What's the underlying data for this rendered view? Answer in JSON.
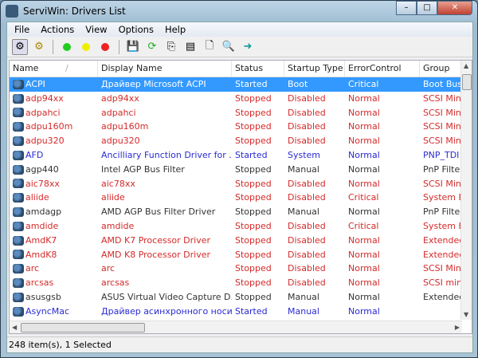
{
  "window": {
    "title": "ServiWin: Drivers List",
    "minimize": "–",
    "maximize": "□",
    "close": "✕"
  },
  "menu": [
    "File",
    "Actions",
    "View",
    "Options",
    "Help"
  ],
  "colors": {
    "red": "#d42a2a",
    "blue": "#2a2ad4",
    "selected": "#3399ff"
  },
  "columns": [
    "Name",
    "Display Name",
    "Status",
    "Startup Type",
    "ErrorControl",
    "Group"
  ],
  "sort_indicator": "/",
  "rows": [
    [
      "ACPI",
      "Драйвер Microsoft ACPI",
      "Started",
      "Boot",
      "Critical",
      "Boot Bus",
      "sel"
    ],
    [
      "adp94xx",
      "adp94xx",
      "Stopped",
      "Disabled",
      "Normal",
      "SCSI Mini",
      "red"
    ],
    [
      "adpahci",
      "adpahci",
      "Stopped",
      "Disabled",
      "Normal",
      "SCSI Mini",
      "red"
    ],
    [
      "adpu160m",
      "adpu160m",
      "Stopped",
      "Disabled",
      "Normal",
      "SCSI Mini",
      "red"
    ],
    [
      "adpu320",
      "adpu320",
      "Stopped",
      "Disabled",
      "Normal",
      "SCSI Mini",
      "red"
    ],
    [
      "AFD",
      "Ancilliary Function Driver for ...",
      "Started",
      "System",
      "Normal",
      "PNP_TDI",
      "blue"
    ],
    [
      "agp440",
      "Intel AGP Bus Filter",
      "Stopped",
      "Manual",
      "Normal",
      "PnP Filter",
      "black"
    ],
    [
      "aic78xx",
      "aic78xx",
      "Stopped",
      "Disabled",
      "Normal",
      "SCSI Mini",
      "red"
    ],
    [
      "aliide",
      "aliide",
      "Stopped",
      "Disabled",
      "Critical",
      "System B",
      "red"
    ],
    [
      "amdagp",
      "AMD AGP Bus Filter Driver",
      "Stopped",
      "Manual",
      "Normal",
      "PnP Filter",
      "black"
    ],
    [
      "amdide",
      "amdide",
      "Stopped",
      "Disabled",
      "Critical",
      "System B",
      "red"
    ],
    [
      "AmdK7",
      "AMD K7 Processor Driver",
      "Stopped",
      "Disabled",
      "Normal",
      "Extended",
      "red"
    ],
    [
      "AmdK8",
      "AMD K8 Processor Driver",
      "Stopped",
      "Disabled",
      "Normal",
      "Extended",
      "red"
    ],
    [
      "arc",
      "arc",
      "Stopped",
      "Disabled",
      "Normal",
      "SCSI Mini",
      "red"
    ],
    [
      "arcsas",
      "arcsas",
      "Stopped",
      "Disabled",
      "Normal",
      "SCSI mini",
      "red"
    ],
    [
      "asusgsb",
      "ASUS Virtual Video Capture D...",
      "Stopped",
      "Manual",
      "Normal",
      "Extended",
      "black"
    ],
    [
      "AsyncMac",
      "Драйвер асинхронного носи...",
      "Started",
      "Manual",
      "Normal",
      "",
      "blue"
    ]
  ],
  "status": "248 item(s), 1 Selected"
}
